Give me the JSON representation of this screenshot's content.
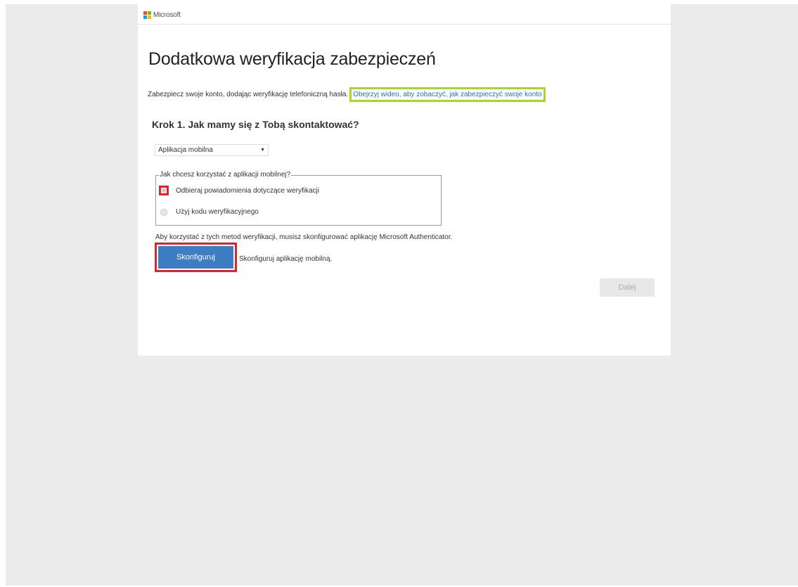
{
  "header": {
    "brand": "Microsoft",
    "logo_colors": [
      "#f25022",
      "#7fba00",
      "#00a4ef",
      "#ffb900"
    ]
  },
  "main": {
    "title": "Dodatkowa weryfikacja zabezpieczeń",
    "intro_text": "Zabezpiecz swoje konto, dodając weryfikację telefoniczną hasła.",
    "video_link": "Obejrzyj wideo, aby zobaczyć, jak zabezpieczyć swoje konto",
    "step_heading": "Krok 1. Jak mamy się z Tobą skontaktować?",
    "contact_method": {
      "selected": "Aplikacja mobilna"
    },
    "mobile_app_options": {
      "legend": "Jak chcesz korzystać z aplikacji mobilnej?",
      "option_notifications": "Odbieraj powiadomienia dotyczące weryfikacji",
      "option_code": "Użyj kodu weryfikacyjnego"
    },
    "authenticator_note": "Aby korzystać z tych metod weryfikacji, musisz skonfigurować aplikację Microsoft Authenticator.",
    "configure_button": "Skonfiguruj",
    "configure_caption": "Skonfiguruj aplikację mobilną.",
    "next_button": "Dalej"
  },
  "colors": {
    "accent": "#3e7cc4",
    "link": "#2a6ebb",
    "highlight_green": "#a8d62a",
    "highlight_red": "#e0222b"
  }
}
